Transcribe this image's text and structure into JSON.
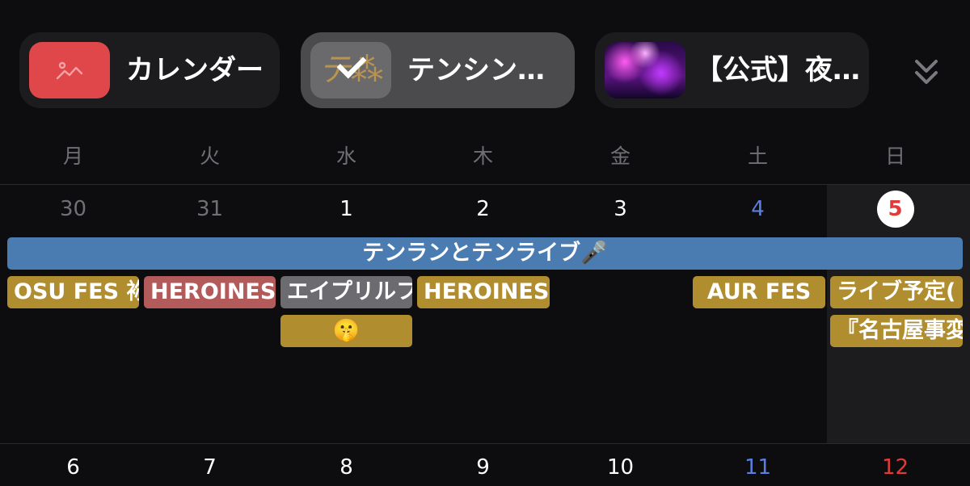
{
  "calendars": [
    {
      "label": "カレンダー",
      "icon": "image-placeholder-icon",
      "color": "#e0474a",
      "selected": false
    },
    {
      "label": "テンシン…",
      "icon": "check-icon",
      "selected": true
    },
    {
      "label": "【公式】夜…",
      "icon": "album-art-thumbnail",
      "selected": false
    }
  ],
  "more_icon": "chevron-double-down-icon",
  "weekdays": [
    "月",
    "火",
    "水",
    "木",
    "金",
    "土",
    "日"
  ],
  "week1": {
    "days": [
      "30",
      "31",
      "1",
      "2",
      "3",
      "4",
      "5"
    ],
    "today": "5",
    "events": {
      "span": "テンランとテンライブ🎤",
      "mon": "OSU FES 袮",
      "tue": "HEROINES",
      "wed1": "エイプリルフ",
      "wed2": "🤫",
      "thu": "HEROINES",
      "sat": "AUR FES",
      "sun1": "ライブ予定(",
      "sun2": "『名古屋事変"
    }
  },
  "week2": {
    "days": [
      "6",
      "7",
      "8",
      "9",
      "10",
      "11",
      "12"
    ]
  },
  "colors": {
    "background": "#0d0d0f",
    "span_event": "#4a7cb2",
    "gold_event": "#b08d2f",
    "red_event": "#b35b5b",
    "gray_event": "#6c6c70",
    "saturday": "#5b7fe0",
    "sunday_today": "#e03b3b"
  }
}
